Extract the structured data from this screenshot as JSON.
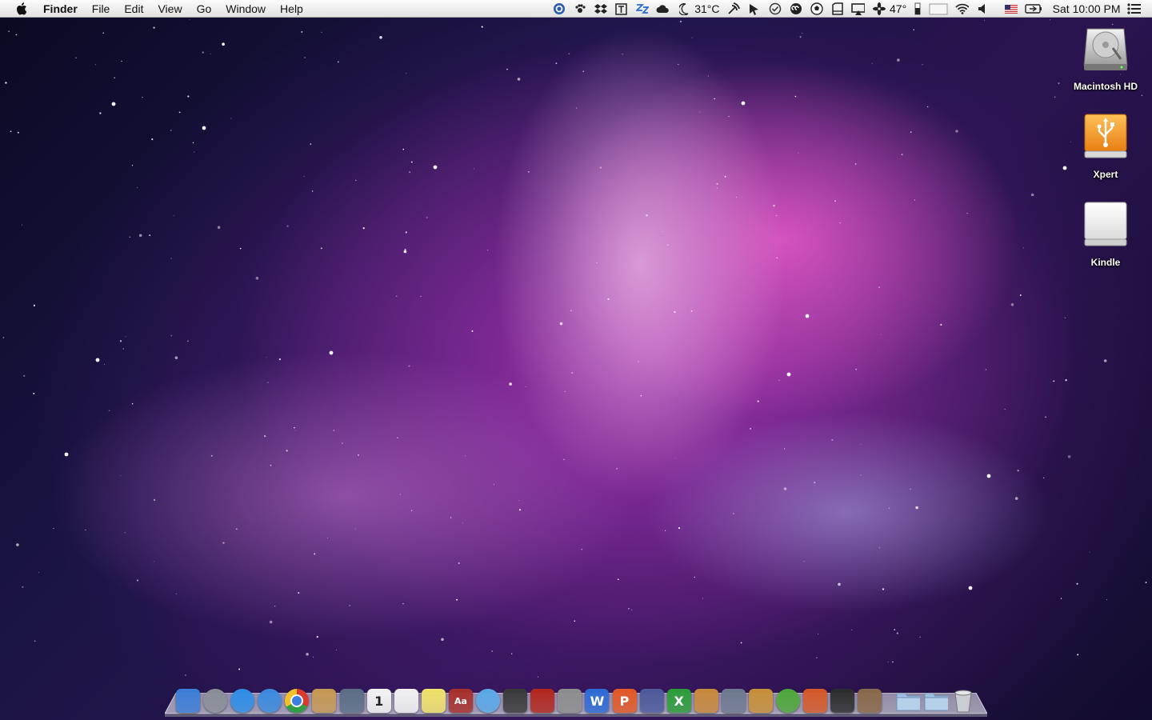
{
  "menubar": {
    "app_name": "Finder",
    "menus": [
      "File",
      "Edit",
      "View",
      "Go",
      "Window",
      "Help"
    ],
    "status": {
      "temperature": "31°C",
      "fan_value": "47°",
      "clock": "Sat 10:00 PM"
    }
  },
  "desktop": {
    "icons": [
      {
        "label": "Macintosh HD",
        "icon": "hard-drive-icon"
      },
      {
        "label": "Xpert",
        "icon": "usb-drive-icon"
      },
      {
        "label": "Kindle",
        "icon": "external-drive-icon"
      }
    ]
  },
  "dock": {
    "items": [
      {
        "name": "finder-icon",
        "color": "#3d7fd9"
      },
      {
        "name": "launchpad-icon",
        "color": "#8a8f99"
      },
      {
        "name": "app-store-icon",
        "color": "#2f8fe8"
      },
      {
        "name": "itunes-icon",
        "color": "#3c8be0"
      },
      {
        "name": "chrome-icon",
        "color": "#e3a827"
      },
      {
        "name": "address-book-icon",
        "color": "#c69a54"
      },
      {
        "name": "iphoto-icon",
        "color": "#5a6f86"
      },
      {
        "name": "ical-icon",
        "color": "#f4f4f4"
      },
      {
        "name": "textedit-icon",
        "color": "#f2f2f2"
      },
      {
        "name": "stickies-icon",
        "color": "#f1e36a"
      },
      {
        "name": "dictionary-icon",
        "color": "#a8312d"
      },
      {
        "name": "messages-icon",
        "color": "#5aaae8"
      },
      {
        "name": "facetime-icon",
        "color": "#3a3a3a"
      },
      {
        "name": "photo-booth-icon",
        "color": "#b3281e"
      },
      {
        "name": "system-preferences-icon",
        "color": "#8e8e8e"
      },
      {
        "name": "word-icon",
        "color": "#2e6bd6"
      },
      {
        "name": "powerpoint-icon",
        "color": "#e35a26"
      },
      {
        "name": "pirate-ship-icon",
        "color": "#4d5b9c"
      },
      {
        "name": "excel-icon",
        "color": "#2c9e3a"
      },
      {
        "name": "keynote-icon",
        "color": "#c98a3c"
      },
      {
        "name": "pen-tool-icon",
        "color": "#6e7a8f"
      },
      {
        "name": "package-icon",
        "color": "#c8913a"
      },
      {
        "name": "utorrent-icon",
        "color": "#4fa83a"
      },
      {
        "name": "home-icon",
        "color": "#d65a2a"
      },
      {
        "name": "terminal-icon",
        "color": "#2d2d2d"
      },
      {
        "name": "preview-icon",
        "color": "#8a6a4a"
      },
      {
        "name": "applications-folder-icon",
        "color": "#8fb4d8"
      },
      {
        "name": "downloads-folder-icon",
        "color": "#8fb4d8"
      },
      {
        "name": "trash-icon",
        "color": "#b9bcc2"
      }
    ],
    "glyphs": {
      "word-icon": "W",
      "excel-icon": "X",
      "powerpoint-icon": "P",
      "ical-icon": "1",
      "dictionary-icon": "Aa"
    }
  }
}
